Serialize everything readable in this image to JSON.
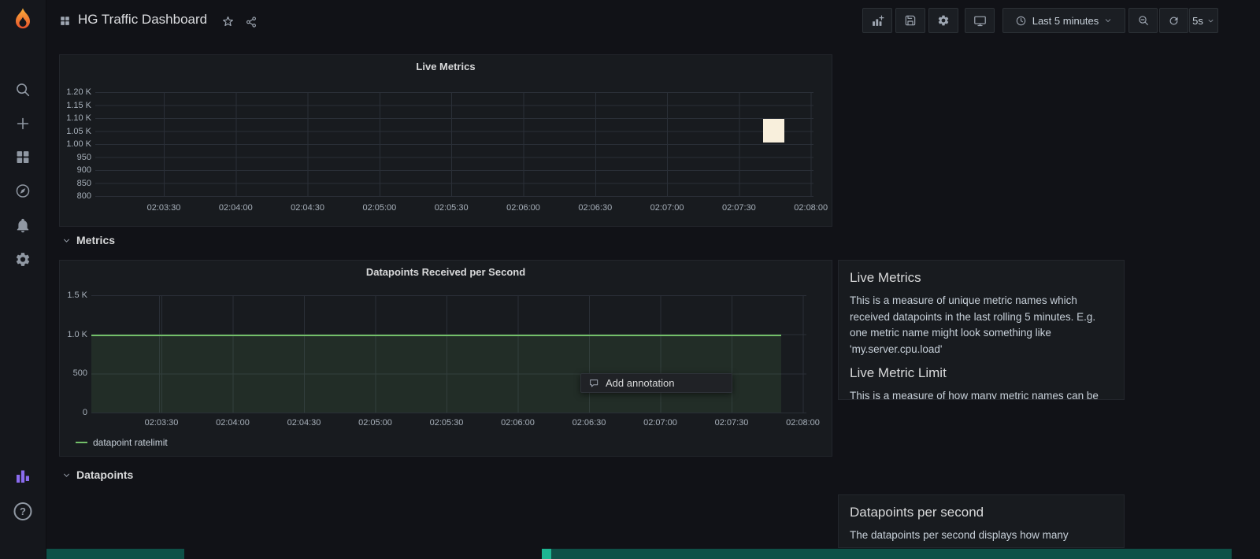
{
  "header": {
    "title": "HG Traffic Dashboard",
    "toolbar": {
      "time_range_label": "Last 5 minutes",
      "refresh_interval": "5s"
    }
  },
  "rows": {
    "metrics": {
      "label": "Metrics"
    },
    "datapoints": {
      "label": "Datapoints"
    }
  },
  "context_menu": {
    "add_annotation": "Add annotation"
  },
  "text_panels": {
    "live": {
      "heading": "Live Metrics",
      "body": "This is a measure of unique metric names which received datapoints in the last rolling 5 minutes. E.g. one metric name might look something like 'my.server.cpu.load'",
      "heading2": "Live Metric Limit",
      "body2": "This is a measure of how many metric names can be"
    },
    "datapoints": {
      "heading": "Datapoints per second",
      "body": "The datapoints per second displays how many"
    }
  },
  "chart_data": [
    {
      "type": "line",
      "title": "Live Metrics",
      "x_ticks": [
        "02:03:30",
        "02:04:00",
        "02:04:30",
        "02:05:00",
        "02:05:30",
        "02:06:00",
        "02:06:30",
        "02:07:00",
        "02:07:30",
        "02:08:00"
      ],
      "y_ticks": [
        "1.20 K",
        "1.15 K",
        "1.10 K",
        "1.05 K",
        "1.00 K",
        "950",
        "900",
        "850",
        "800"
      ],
      "ylim": [
        800,
        1200
      ],
      "grid": true,
      "series": [],
      "highlight": {
        "x": "02:07:30",
        "y_range": [
          1000,
          1060
        ]
      }
    },
    {
      "type": "area",
      "title": "Datapoints Received per Second",
      "x_ticks": [
        "02:03:30",
        "02:04:00",
        "02:04:30",
        "02:05:00",
        "02:05:30",
        "02:06:00",
        "02:06:30",
        "02:07:00",
        "02:07:30",
        "02:08:00"
      ],
      "y_ticks": [
        "1.5 K",
        "1.0 K",
        "500",
        "0"
      ],
      "ylim": [
        0,
        1500
      ],
      "grid": true,
      "legend_position": "bottom-left",
      "series": [
        {
          "name": "datapoint ratelimit",
          "constant_value": 1000,
          "color": "#73bf69"
        }
      ]
    }
  ],
  "icons": {
    "help_glyph": "?"
  },
  "icon_names": [
    "grafana-logo",
    "search",
    "add",
    "dashboards",
    "explore",
    "alerting",
    "settings",
    "plugin",
    "help",
    "dashboard-grid",
    "star",
    "share",
    "add-panel",
    "save",
    "dashboard-settings",
    "cycle-view",
    "clock",
    "caret-down",
    "zoom-out",
    "refresh",
    "chevron-down",
    "comment-bubble"
  ],
  "colors": {
    "background": "#111217",
    "panel": "#181b1f",
    "accent_orange": "#f05a28",
    "series_green": "#73bf69",
    "plugin_purple": "#8b6cef",
    "below_fold_teal": "#0e5148",
    "highlight_cream": "#f8efdc"
  }
}
